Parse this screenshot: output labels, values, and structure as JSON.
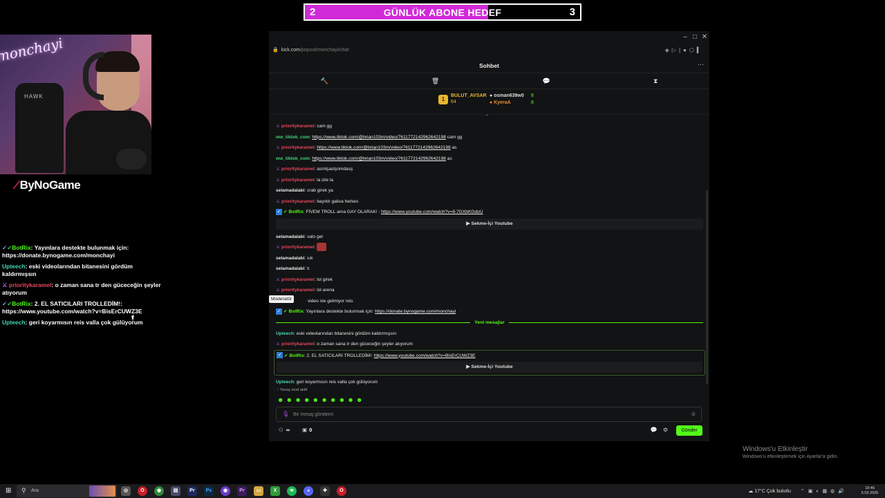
{
  "goal": {
    "current": "2",
    "title": "GÜNLÜK ABONE HEDEF",
    "target": "3",
    "progress": 0.6667,
    "fill_color": "#d02ad8"
  },
  "webcam": {
    "neon_text": "monchayi",
    "chair_text": "HAWK",
    "brand": "ByNoGame"
  },
  "overlay_chat": [
    {
      "user": "BotRix",
      "text": "Yayınlara destekte bulunmak için: https://donate.bynogame.com/monchayi"
    },
    {
      "user": "Upteech",
      "text": "eski videolarından bitanesini gördüm kaldırmışsın"
    },
    {
      "user": "prioritykaramel",
      "text": "o zaman sana tr den güceceğin şeyler atıyorum"
    },
    {
      "user": "BotRix",
      "text": "2. EL SATICILARI TROLLEDİM!: https://www.youtube.com/watch?v=BisErCUWZ3E"
    },
    {
      "user": "Upteech",
      "text": "geri koyarmısın reis valla çok gülüyorum"
    }
  ],
  "browser": {
    "url_host": "kick.com",
    "url_path": "/popout/monchayi/chat",
    "chat_title": "Sohbet",
    "leaderboard": {
      "rank": "1",
      "first_name": "BULUT_AVSAR",
      "first_value": "64",
      "second_name": "osman639w0",
      "second_value": "8",
      "third_name": "KyeraA",
      "third_value": "8"
    },
    "messages": [
      {
        "user": "prioritykaramel",
        "text": "cam gg"
      },
      {
        "user": "ww_tiktok_com",
        "link": "https://www.tiktok.com/@brian103m/video/7611772142962642198",
        "after": "cam gg"
      },
      {
        "user": "prioritykaramel",
        "link": "https://www.tiktok.com/@brian103m/video/7611772142962642198",
        "after": "as"
      },
      {
        "user": "ww_tiktok_com",
        "link": "https://www.tiktok.com/@brian103m/video/7611772142962642198",
        "after": "as"
      },
      {
        "user": "prioritykaramel",
        "text": "asmlşaslşnmdasş"
      },
      {
        "user": "prioritykaramel",
        "text": "la izle la"
      },
      {
        "user": "selamadalabi",
        "text": "crab girek ya"
      },
      {
        "user": "prioritykaramel",
        "text": "bayıldı galiva herkes"
      },
      {
        "user": "BotRix",
        "text": "FİVEM TROLL ama GAY OLARAK! :",
        "link": "https://www.youtube.com/watch?v=8-7GXbKGdoU"
      },
      {
        "user": "selamadalabi",
        "text": "valo gel"
      },
      {
        "user": "prioritykaramel",
        "text": ""
      },
      {
        "user": "selamadalabi",
        "text": "sık"
      },
      {
        "user": "selamadalabi",
        "text": "tı"
      },
      {
        "user": "prioritykaramel",
        "text": "lol girek"
      },
      {
        "user": "prioritykaramel",
        "text": "lol arena"
      },
      {
        "user": "",
        "text": "video nie gelmiyor reis"
      },
      {
        "user": "BotRix",
        "text": "Yayınlara destekte bulunmak için:",
        "link": "https://donate.bynogame.com/monchayi"
      },
      {
        "user": "Upteech",
        "text": "eski videolarından bitanesini gördüm kaldırmışsın"
      },
      {
        "user": "prioritykaramel",
        "text": "o zaman sana tr den güceceğin şeyler atıyorum"
      },
      {
        "user": "BotRix",
        "text": "2. EL SATICILARI TROLLEDİM!:",
        "link": "https://www.youtube.com/watch?v=BisErCUWZ3E"
      },
      {
        "user": "Upteech",
        "text": "geri koyarmısın reis valla çok gülüyorum"
      }
    ],
    "embed_label": "Sekme-İçi Youtube",
    "new_messages": "Yeni mesajlar",
    "tooltip": "Moderatör",
    "slow_mode": "Yavaş mod aktif",
    "input_placeholder": "Bir mesaj gönderin",
    "viewers_label": "∞",
    "points": "0",
    "send_label": "Gönder"
  },
  "watermark": {
    "title": "Windows'u Etkinleştir",
    "subtitle": "Windows'u etkinleştirmek için Ayarlar'a gidin."
  },
  "taskbar": {
    "search_placeholder": "Ara",
    "weather": "17°C  Çok bulutlu",
    "time": "18:46",
    "date": "5.03.2026"
  }
}
